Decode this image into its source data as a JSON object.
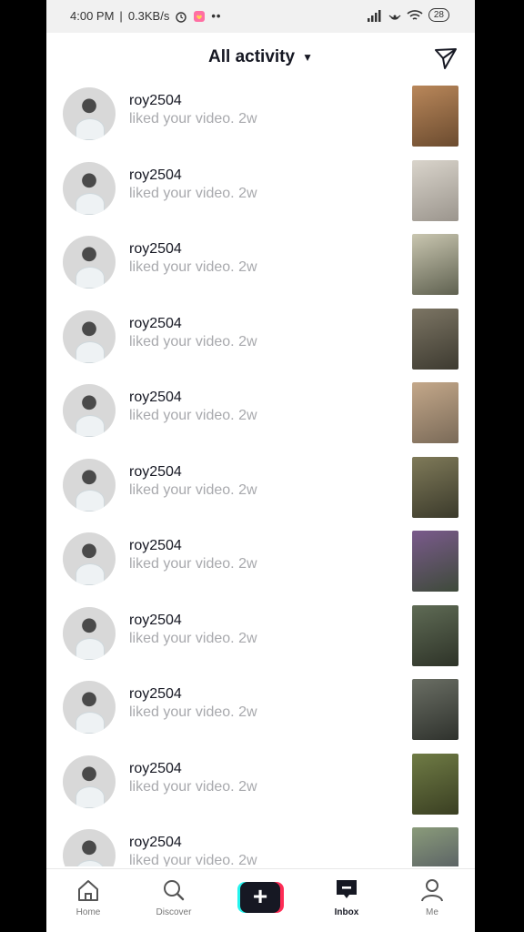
{
  "status_bar": {
    "time": "4:00 PM",
    "speed": "0.3KB/s",
    "battery": "28"
  },
  "header": {
    "title": "All activity"
  },
  "activity": [
    {
      "user": "roy2504",
      "action": "liked your video. 2w",
      "thumb": [
        "#b9875a",
        "#6b4b2f"
      ]
    },
    {
      "user": "roy2504",
      "action": "liked your video. 2w",
      "thumb": [
        "#d9d4cb",
        "#9b958d"
      ]
    },
    {
      "user": "roy2504",
      "action": "liked your video. 2w",
      "thumb": [
        "#c9c6b0",
        "#5f6150"
      ]
    },
    {
      "user": "roy2504",
      "action": "liked your video. 2w",
      "thumb": [
        "#7c7564",
        "#3d3a30"
      ]
    },
    {
      "user": "roy2504",
      "action": "liked your video. 2w",
      "thumb": [
        "#c4a88a",
        "#7a6a58"
      ]
    },
    {
      "user": "roy2504",
      "action": "liked your video. 2w",
      "thumb": [
        "#7f7a59",
        "#3b3a2b"
      ]
    },
    {
      "user": "roy2504",
      "action": "liked your video. 2w",
      "thumb": [
        "#7a5a8c",
        "#3e4a3a"
      ]
    },
    {
      "user": "roy2504",
      "action": "liked your video. 2w",
      "thumb": [
        "#5f6b55",
        "#2e3328"
      ]
    },
    {
      "user": "roy2504",
      "action": "liked your video. 2w",
      "thumb": [
        "#6a6e64",
        "#2f322d"
      ]
    },
    {
      "user": "roy2504",
      "action": "liked your video. 2w",
      "thumb": [
        "#6f7b45",
        "#3a3f22"
      ]
    },
    {
      "user": "roy2504",
      "action": "liked your video. 2w",
      "thumb": [
        "#8a9b7a",
        "#4b4f5e"
      ]
    }
  ],
  "bottom_nav": {
    "home": "Home",
    "discover": "Discover",
    "inbox": "Inbox",
    "me": "Me"
  },
  "colors": {
    "accent_cyan": "#25f4ee",
    "accent_pink": "#fe2c55",
    "text_primary": "#161823",
    "text_secondary": "#a8a9ad"
  }
}
